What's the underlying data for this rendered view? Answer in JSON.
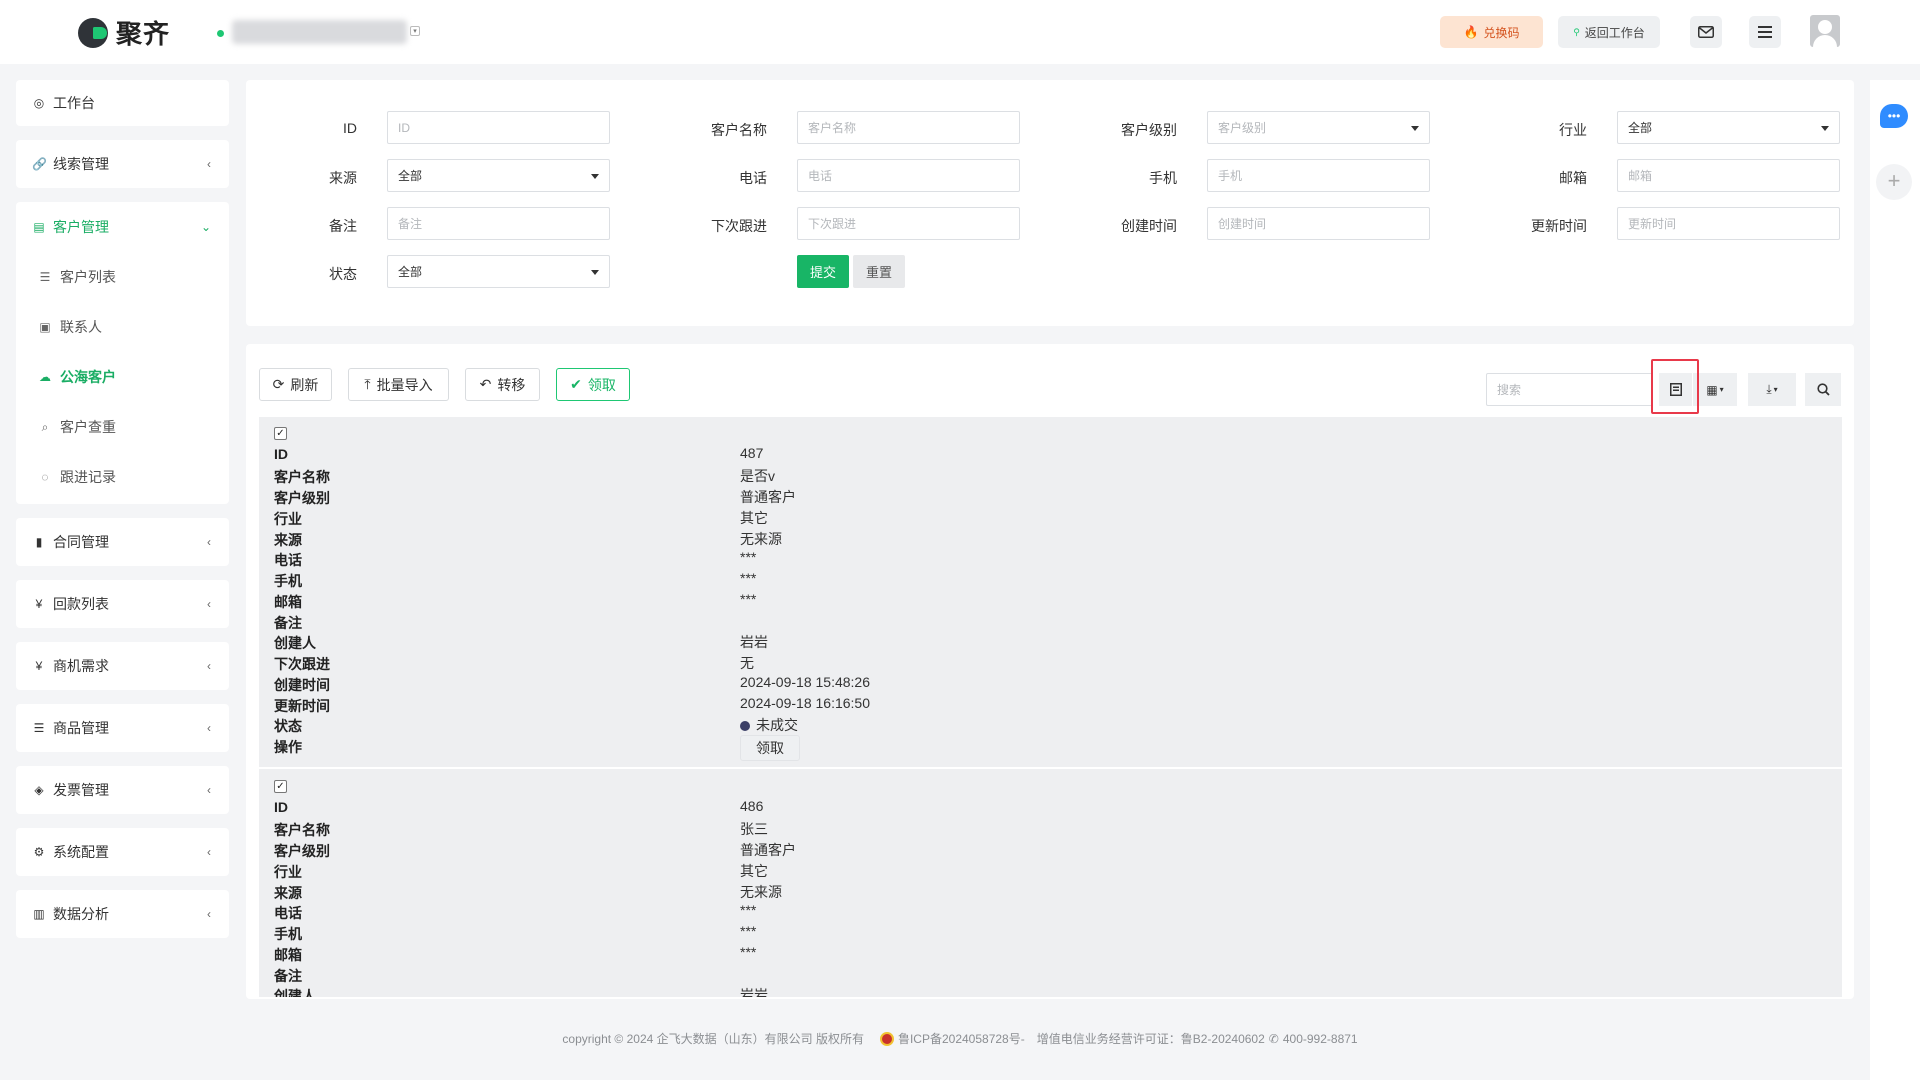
{
  "app": {
    "logo_text": "聚齐",
    "company_name": "",
    "redeem_label": "兑换码",
    "return_label": "返回工作台"
  },
  "colors": {
    "accent": "#18b566",
    "redeem_text": "#d4521d",
    "highlight": "#e8394a"
  },
  "sidebar": {
    "items": [
      {
        "label": "工作台",
        "icon": "dashboard-icon"
      },
      {
        "label": "线索管理",
        "icon": "link-icon"
      },
      {
        "label": "客户管理",
        "icon": "id-card-icon",
        "expanded": true
      },
      {
        "label": "合同管理",
        "icon": "bookmark-icon"
      },
      {
        "label": "回款列表",
        "icon": "yen-icon"
      },
      {
        "label": "商机需求",
        "icon": "yen-icon"
      },
      {
        "label": "商品管理",
        "icon": "list-icon"
      },
      {
        "label": "发票管理",
        "icon": "tag-icon"
      },
      {
        "label": "系统配置",
        "icon": "gears-icon"
      },
      {
        "label": "数据分析",
        "icon": "bar-chart-icon"
      }
    ],
    "sub_items": [
      {
        "label": "客户列表",
        "icon": "list-icon"
      },
      {
        "label": "联系人",
        "icon": "contact-icon"
      },
      {
        "label": "公海客户",
        "icon": "cloud-icon",
        "active": true
      },
      {
        "label": "客户查重",
        "icon": "search-icon"
      },
      {
        "label": "跟进记录",
        "icon": "chat-icon"
      }
    ]
  },
  "filters": {
    "id": {
      "label": "ID",
      "placeholder": "ID"
    },
    "customer_name": {
      "label": "客户名称",
      "placeholder": "客户名称"
    },
    "customer_level": {
      "label": "客户级别",
      "placeholder": "客户级别"
    },
    "industry": {
      "label": "行业",
      "value": "全部"
    },
    "source": {
      "label": "来源",
      "value": "全部"
    },
    "phone": {
      "label": "电话",
      "placeholder": "电话"
    },
    "mobile": {
      "label": "手机",
      "placeholder": "手机"
    },
    "email": {
      "label": "邮箱",
      "placeholder": "邮箱"
    },
    "remark": {
      "label": "备注",
      "placeholder": "备注"
    },
    "next_followup": {
      "label": "下次跟进",
      "placeholder": "下次跟进"
    },
    "created_at": {
      "label": "创建时间",
      "placeholder": "创建时间"
    },
    "updated_at": {
      "label": "更新时间",
      "placeholder": "更新时间"
    },
    "status": {
      "label": "状态",
      "value": "全部"
    },
    "submit_label": "提交",
    "reset_label": "重置"
  },
  "toolbar": {
    "refresh_label": "刷新",
    "import_label": "批量导入",
    "transfer_label": "转移",
    "claim_label": "领取",
    "search_placeholder": "搜索"
  },
  "field_labels": [
    "ID",
    "客户名称",
    "客户级别",
    "行业",
    "来源",
    "电话",
    "手机",
    "邮箱",
    "备注",
    "创建人",
    "下次跟进",
    "创建时间",
    "更新时间",
    "状态",
    "操作"
  ],
  "records": [
    {
      "values": [
        "487",
        "是否v",
        "普通客户",
        "其它",
        "无来源",
        "***",
        "***",
        "***",
        "",
        "岩岩",
        "无",
        "2024-09-18 15:48:26",
        "2024-09-18 16:16:50"
      ],
      "status": "未成交",
      "action": "领取"
    },
    {
      "values": [
        "486",
        "张三",
        "普通客户",
        "其它",
        "无来源",
        "***",
        "***",
        "***",
        "",
        "岩岩"
      ],
      "status": "",
      "action": ""
    }
  ],
  "footer": {
    "copyright": "copyright © 2024 企飞大数据（山东）有限公司 版权所有",
    "icp": "鲁ICP备2024058728号-",
    "license": "增值电信业务经营许可证：鲁B2-20240602",
    "phone": "400-992-8871"
  }
}
